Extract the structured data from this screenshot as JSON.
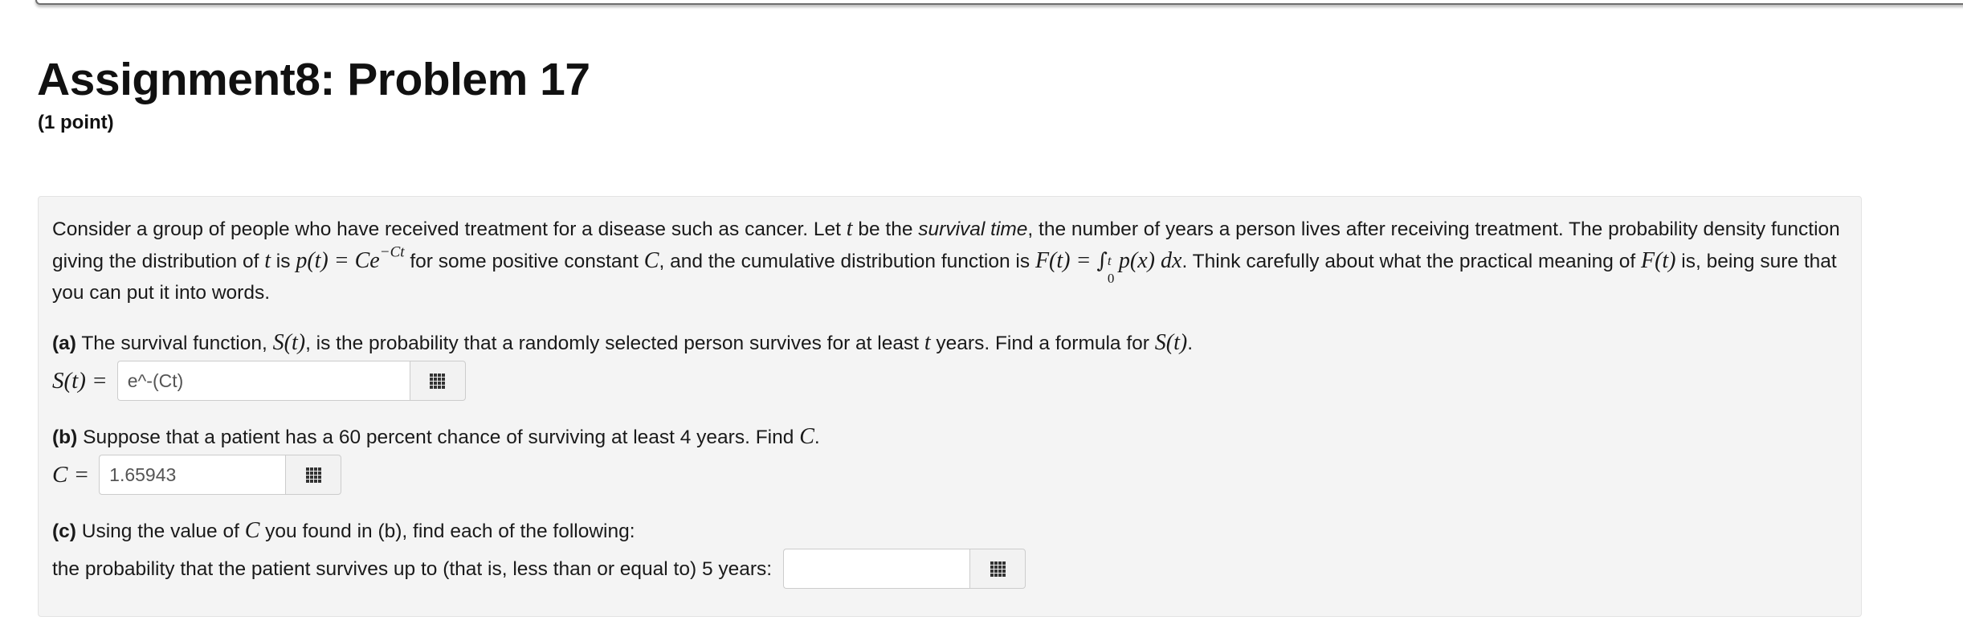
{
  "header": {
    "title": "Assignment8: Problem 17",
    "points": "(1 point)"
  },
  "intro": {
    "t1": "Consider a group of people who have received treatment for a disease such as cancer. Let ",
    "var_t": "t",
    "t2": " be the ",
    "emph": "survival time",
    "t3": ", the number of years a person lives after receiving treatment. The probability density function giving the distribution of ",
    "t4": " is ",
    "density_lhs": "p(t) = Ce",
    "density_exp": "−Ct",
    "t5": " for some positive constant ",
    "var_C": "C",
    "t6": ", and the cumulative distribution function is ",
    "cdf_lhs": "F(t) = ",
    "integral_sign": "∫",
    "integral_upper": "t",
    "integral_lower": "0",
    "integrand": "p(x) dx",
    "t7": ". Think carefully about what the practical meaning of ",
    "cdf_name": "F(t)",
    "t8": " is, being sure that you can put it into words."
  },
  "part_a": {
    "tag": "(a)",
    "text1": " The survival function, ",
    "func": "S(t)",
    "text2": ", is the probability that a randomly selected person survives for at least ",
    "var": "t",
    "text3": " years. Find a formula for ",
    "text4": ".",
    "answer_label": "S(t) =",
    "answer_value": "e^-(Ct)"
  },
  "part_b": {
    "tag": "(b)",
    "text1": " Suppose that a patient has a 60 percent chance of surviving at least 4 years. Find ",
    "var": "C",
    "text2": ".",
    "answer_label": "C =",
    "answer_value": "1.65943"
  },
  "part_c": {
    "tag": "(c)",
    "text1": " Using the value of ",
    "var": "C",
    "text2": " you found in (b), find each of the following:",
    "question": "the probability that the patient survives up to (that is, less than or equal to) 5 years:",
    "answer_value": ""
  },
  "icons": {
    "palette": "equation-palette-grid-icon"
  }
}
